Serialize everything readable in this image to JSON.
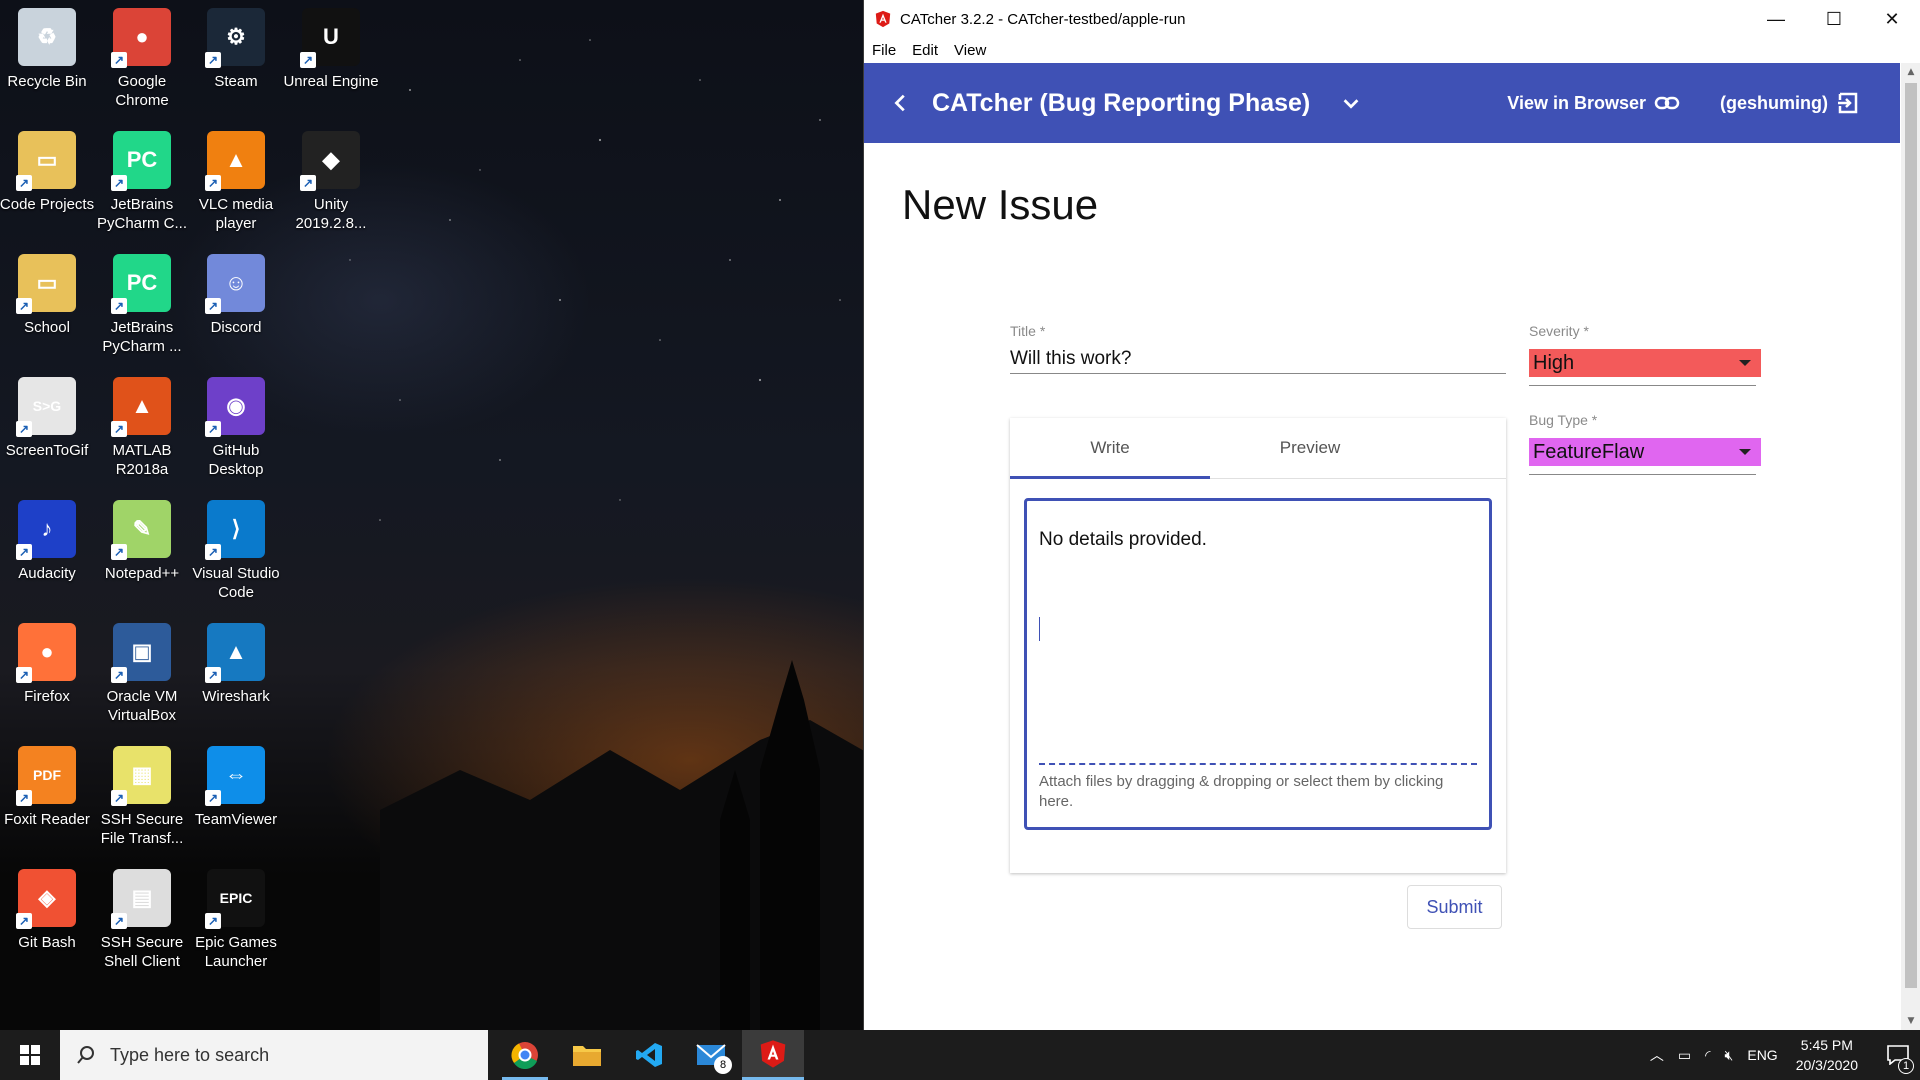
{
  "desktop": {
    "icons": [
      {
        "label": "Recycle Bin",
        "name": "recycle-bin-icon",
        "color": "#c9d3dc",
        "glyph": "♻"
      },
      {
        "label": "Google Chrome",
        "name": "google-chrome-icon",
        "color": "#db4437",
        "glyph": "●"
      },
      {
        "label": "Steam",
        "name": "steam-icon",
        "color": "#1b2838",
        "glyph": "⚙"
      },
      {
        "label": "Unreal Engine",
        "name": "unreal-engine-icon",
        "color": "#111111",
        "glyph": "U"
      },
      {
        "label": "Code Projects",
        "name": "folder-icon",
        "color": "#e8c15a",
        "glyph": "▭"
      },
      {
        "label": "JetBrains PyCharm C...",
        "name": "pycharm-icon",
        "color": "#21d789",
        "glyph": "PC"
      },
      {
        "label": "VLC media player",
        "name": "vlc-icon",
        "color": "#f08010",
        "glyph": "▲"
      },
      {
        "label": "Unity 2019.2.8...",
        "name": "unity-icon",
        "color": "#222222",
        "glyph": "◆"
      },
      {
        "label": "School",
        "name": "folder-icon",
        "color": "#e8c15a",
        "glyph": "▭"
      },
      {
        "label": "JetBrains PyCharm ...",
        "name": "pycharm-icon",
        "color": "#21d789",
        "glyph": "PC"
      },
      {
        "label": "Discord",
        "name": "discord-icon",
        "color": "#7289da",
        "glyph": "☺"
      },
      {
        "label": "",
        "name": "blank-icon",
        "color": "",
        "glyph": ""
      },
      {
        "label": "ScreenToGif",
        "name": "screentogif-icon",
        "color": "#e6e6e6",
        "glyph": "S>G"
      },
      {
        "label": "MATLAB R2018a",
        "name": "matlab-icon",
        "color": "#e0521a",
        "glyph": "▲"
      },
      {
        "label": "GitHub Desktop",
        "name": "github-desktop-icon",
        "color": "#6e40c9",
        "glyph": "◉"
      },
      {
        "label": "",
        "name": "blank-icon",
        "color": "",
        "glyph": ""
      },
      {
        "label": "Audacity",
        "name": "audacity-icon",
        "color": "#1e40c8",
        "glyph": "♪"
      },
      {
        "label": "Notepad++",
        "name": "notepadpp-icon",
        "color": "#a0d468",
        "glyph": "✎"
      },
      {
        "label": "Visual Studio Code",
        "name": "vscode-icon",
        "color": "#0a7acc",
        "glyph": "⟩"
      },
      {
        "label": "",
        "name": "blank-icon",
        "color": "",
        "glyph": ""
      },
      {
        "label": "Firefox",
        "name": "firefox-icon",
        "color": "#ff7139",
        "glyph": "●"
      },
      {
        "label": "Oracle VM VirtualBox",
        "name": "virtualbox-icon",
        "color": "#2d5b9a",
        "glyph": "▣"
      },
      {
        "label": "Wireshark",
        "name": "wireshark-icon",
        "color": "#1679c1",
        "glyph": "▲"
      },
      {
        "label": "",
        "name": "blank-icon",
        "color": "",
        "glyph": ""
      },
      {
        "label": "Foxit Reader",
        "name": "foxit-reader-icon",
        "color": "#f48220",
        "glyph": "PDF"
      },
      {
        "label": "SSH Secure File Transf...",
        "name": "ssh-file-transfer-icon",
        "color": "#e8e26a",
        "glyph": "▦"
      },
      {
        "label": "TeamViewer",
        "name": "teamviewer-icon",
        "color": "#0e8ee9",
        "glyph": "⇔"
      },
      {
        "label": "",
        "name": "blank-icon",
        "color": "",
        "glyph": ""
      },
      {
        "label": "Git Bash",
        "name": "git-bash-icon",
        "color": "#f05133",
        "glyph": "◈"
      },
      {
        "label": "SSH Secure Shell Client",
        "name": "ssh-shell-icon",
        "color": "#dddddd",
        "glyph": "▤"
      },
      {
        "label": "Epic Games Launcher",
        "name": "epic-games-icon",
        "color": "#111111",
        "glyph": "EPIC"
      }
    ]
  },
  "window": {
    "title": "CATcher 3.2.2 - CATcher-testbed/apple-run",
    "menu": [
      "File",
      "Edit",
      "View"
    ],
    "controls": {
      "minimize": "—",
      "maximize": "☐",
      "close": "✕"
    }
  },
  "toolbar": {
    "app_title": "CATcher  (Bug Reporting Phase)",
    "view_in_browser": "View in Browser",
    "user": "(geshuming)",
    "accent": "#3f51b5"
  },
  "form": {
    "page_title": "New Issue",
    "title_label": "Title *",
    "title_value": "Will this work?",
    "severity_label": "Severity *",
    "severity_value": "High",
    "severity_color": "#f35a5a",
    "bug_type_label": "Bug Type *",
    "bug_type_value": "FeatureFlaw",
    "bug_type_color": "#e066f0",
    "tabs": [
      "Write",
      "Preview"
    ],
    "description": "No details provided.",
    "attach_hint": "Attach files by dragging & dropping or select them by clicking here.",
    "submit_label": "Submit"
  },
  "taskbar": {
    "search_placeholder": "Type here to search",
    "apps": [
      "chrome-icon",
      "file-explorer-icon",
      "vscode-icon",
      "mail-icon",
      "catcher-icon"
    ],
    "mail_badge": "8",
    "language": "ENG",
    "time": "5:45 PM",
    "date": "20/3/2020",
    "notification_count": "1"
  }
}
